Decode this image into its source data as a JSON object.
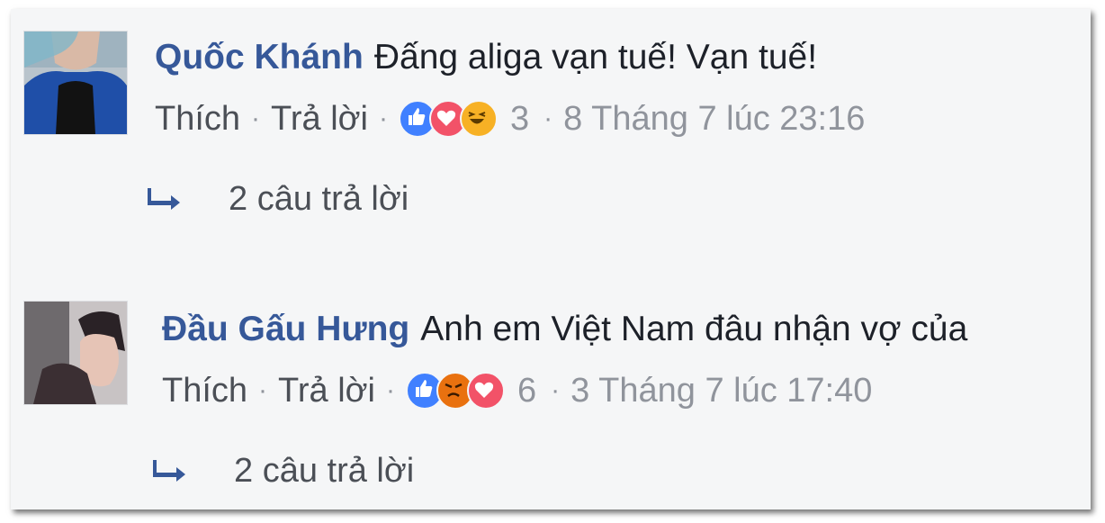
{
  "comments": [
    {
      "author": "Quốc Khánh",
      "text": "Đấng aliga vạn tuế! Vạn tuế!",
      "like_label": "Thích",
      "reply_label": "Trả lời",
      "reactions": [
        "like-icon",
        "love-icon",
        "haha-icon"
      ],
      "reaction_count": "3",
      "timestamp": "8 Tháng 7 lúc 23:16",
      "replies_label": "2 câu trả lời"
    },
    {
      "author": "Đầu Gấu Hưng",
      "text": "Anh em Việt Nam đâu nhận vợ của",
      "like_label": "Thích",
      "reply_label": "Trả lời",
      "reactions": [
        "like-icon",
        "angry-icon",
        "love-icon"
      ],
      "reaction_count": "6",
      "timestamp": "3 Tháng 7 lúc 17:40",
      "replies_label": "2 câu trả lời"
    }
  ],
  "colors": {
    "author": "#365899",
    "meta": "#90949c",
    "like": "#4080ff",
    "love": "#f25268",
    "haha": "#f7b125",
    "angry": "#e9710f"
  }
}
